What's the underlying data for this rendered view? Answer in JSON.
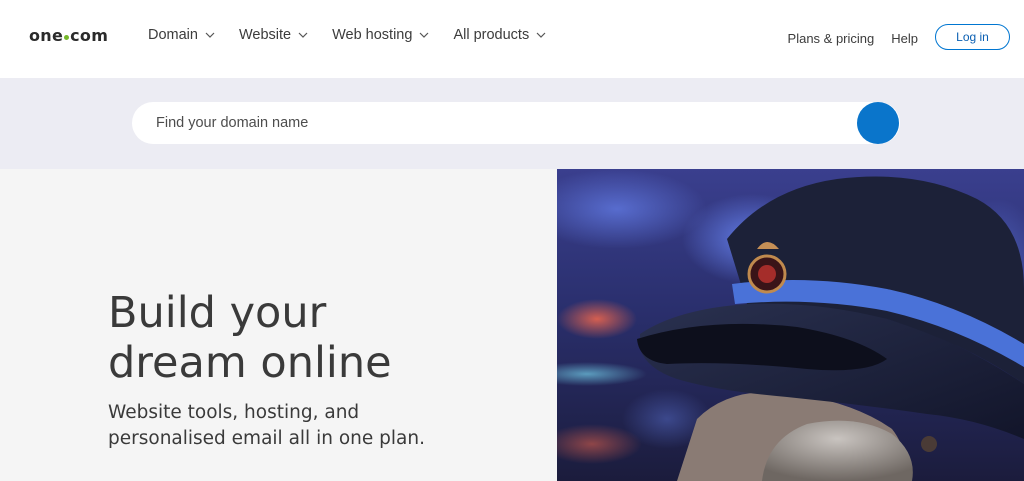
{
  "brand": {
    "name_left": "one",
    "name_right": "com",
    "dot_color": "#76b82a"
  },
  "nav": {
    "items": [
      {
        "label": "Domain"
      },
      {
        "label": "Website"
      },
      {
        "label": "Web hosting"
      },
      {
        "label": "All products"
      }
    ],
    "right": {
      "plans_label": "Plans & pricing",
      "help_label": "Help",
      "login_label": "Log in"
    }
  },
  "search": {
    "placeholder": "Find your domain name",
    "button_color": "#0a75cb"
  },
  "hero": {
    "title_line1": "Build your",
    "title_line2": "dream online",
    "subtitle_line1": "Website tools, hosting, and",
    "subtitle_line2": "personalised email all in one plan."
  },
  "colors": {
    "accent": "#0a75cb",
    "band": "#ececf3",
    "hero_bg": "#f5f5f5"
  }
}
